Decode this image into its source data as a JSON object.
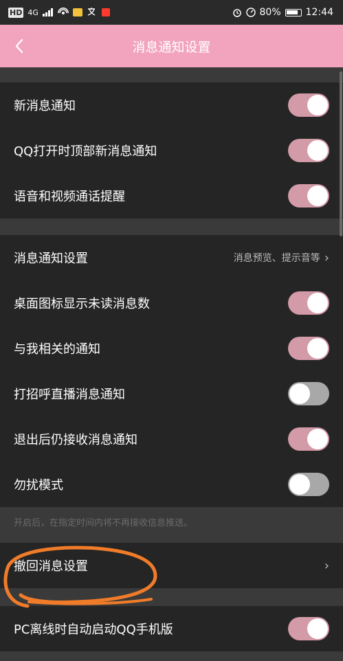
{
  "status_bar": {
    "hd": "HD",
    "network": "4G",
    "battery": "80%",
    "time": "12:44"
  },
  "header": {
    "title": "消息通知设置"
  },
  "colors": {
    "header_bg": "#f2a3bd",
    "toggle_on": "#d39aa8",
    "toggle_off": "#a8a8a8",
    "row_bg": "#252525",
    "annotation": "#f07c2a"
  },
  "rows": [
    {
      "label": "新消息通知",
      "toggle": "on"
    },
    {
      "label": "QQ打开时顶部新消息通知",
      "toggle": "on"
    },
    {
      "label": "语音和视频通话提醒",
      "toggle": "on"
    },
    {
      "label": "消息通知设置",
      "detail": "消息预览、提示音等"
    },
    {
      "label": "桌面图标显示未读消息数",
      "toggle": "on"
    },
    {
      "label": "与我相关的通知",
      "toggle": "on"
    },
    {
      "label": "打招呼直播消息通知",
      "toggle": "off"
    },
    {
      "label": "退出后仍接收消息通知",
      "toggle": "on"
    },
    {
      "label": "勿扰模式",
      "toggle": "off"
    },
    {
      "label": "撤回消息设置",
      "detail": ""
    },
    {
      "label": "PC离线时自动启动QQ手机版",
      "toggle": "on"
    }
  ],
  "dnd_hint": "开启后，在指定时间内将不再接收信息推送。"
}
